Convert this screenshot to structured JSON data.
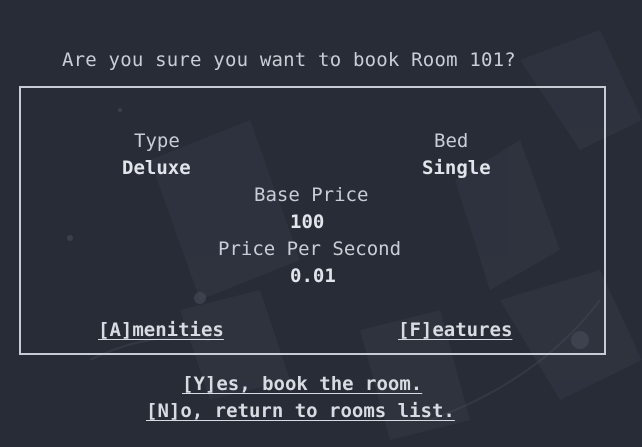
{
  "prompt": {
    "question": "Are you sure you want to book Room 101?"
  },
  "room": {
    "type_label": "Type",
    "type_value": "Deluxe",
    "bed_label": "Bed",
    "bed_value": "Single",
    "base_price_label": "Base Price",
    "base_price_value": "100",
    "price_per_second_label": "Price Per Second",
    "price_per_second_value": "0.01"
  },
  "links": {
    "amenities": "[A]menities",
    "features": "[F]eatures"
  },
  "actions": {
    "yes": "[Y]es, book the room.",
    "no": "[N]o, return to rooms list."
  },
  "colors": {
    "background": "#282c36",
    "text": "#c9cdd6",
    "border": "#c7cbd3"
  }
}
